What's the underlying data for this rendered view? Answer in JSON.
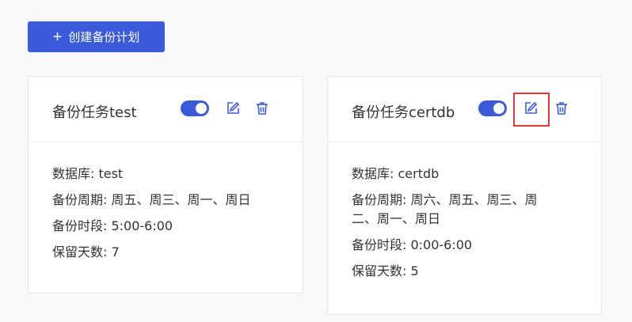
{
  "toolbar": {
    "create_label": "创建备份计划",
    "plus": "+"
  },
  "colors": {
    "accent": "#3b5bdb",
    "highlight": "#e53935"
  },
  "cards": [
    {
      "title": "备份任务test",
      "enabled": true,
      "database": "数据库: test",
      "cycle": "备份周期: 周五、周三、周一、周日",
      "window": "备份时段: 5:00-6:00",
      "retention": "保留天数: 7",
      "icons": {
        "toggle": "toggle-switch",
        "edit": "edit-icon",
        "delete": "trash-icon"
      }
    },
    {
      "title": "备份任务certdb",
      "enabled": true,
      "database": "数据库: certdb",
      "cycle": "备份周期: 周六、周五、周三、周二、周一、周日",
      "window": "备份时段: 0:00-6:00",
      "retention": "保留天数: 5",
      "icons": {
        "toggle": "toggle-switch",
        "edit": "edit-icon",
        "delete": "trash-icon"
      }
    }
  ]
}
